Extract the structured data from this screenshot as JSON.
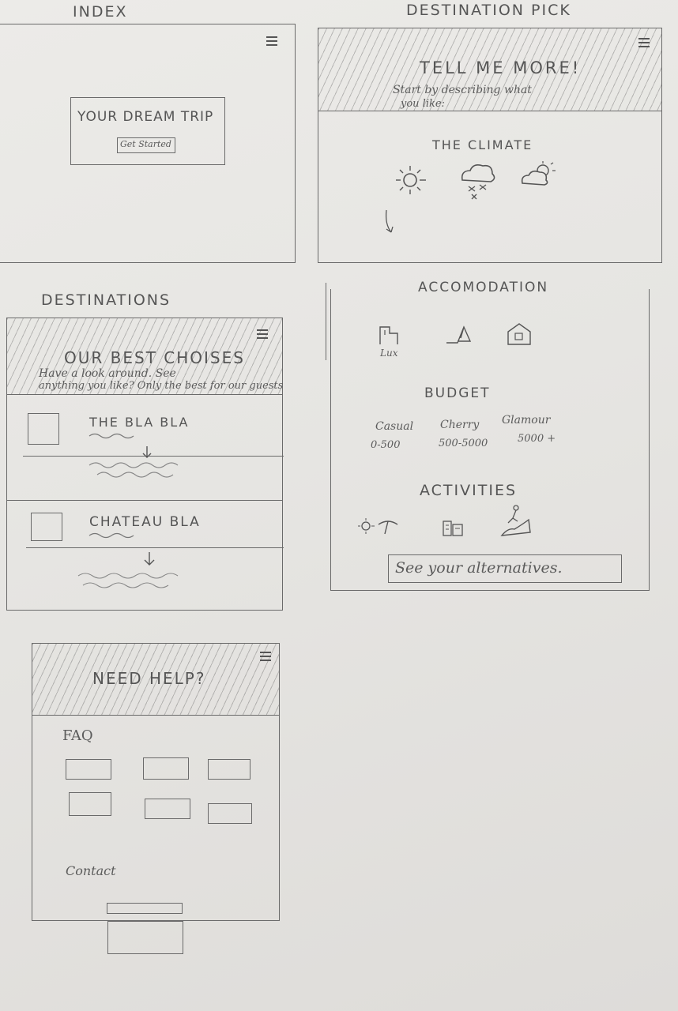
{
  "index": {
    "label": "INDEX",
    "hero_title": "YOUR DREAM TRIP",
    "cta": "Get Started"
  },
  "destination_pick": {
    "label": "DESTINATION PICK",
    "heading": "TELL ME MORE!",
    "subtext_line1": "Start by describing what",
    "subtext_line2": "you like:",
    "climate_title": "THE CLIMATE",
    "climate_icons": [
      "sun-icon",
      "snow-cloud-icon",
      "sun-cloud-icon"
    ]
  },
  "accommodation": {
    "title": "ACCOMODATION",
    "icons": [
      "hotel-icon",
      "tent-icon",
      "house-icon"
    ],
    "lux_label": "Lux",
    "budget_title": "BUDGET",
    "budget_options": [
      {
        "name": "Casual",
        "range": "0-500"
      },
      {
        "name": "Cherry",
        "range": "500-5000"
      },
      {
        "name": "Glamour",
        "range": "5000 +"
      }
    ],
    "activities_title": "ACTIVITIES",
    "activity_icons": [
      "beach-icon",
      "city-icon",
      "hiking-icon"
    ],
    "cta": "See your alternatives."
  },
  "destinations": {
    "label": "DESTINATIONS",
    "heading": "OUR BEST CHOISES",
    "subtext_line1": "Have a look around. See",
    "subtext_line2": "anything you like? Only the best for our guests",
    "items": [
      {
        "title": "THE BLA BLA"
      },
      {
        "title": "CHATEAU BLA"
      }
    ]
  },
  "help": {
    "heading": "NEED HELP?",
    "faq_label": "FAQ",
    "contact_label": "Contact"
  },
  "colors": {
    "pencil": "#5a5a5a",
    "paper": "#e8e7e4"
  }
}
